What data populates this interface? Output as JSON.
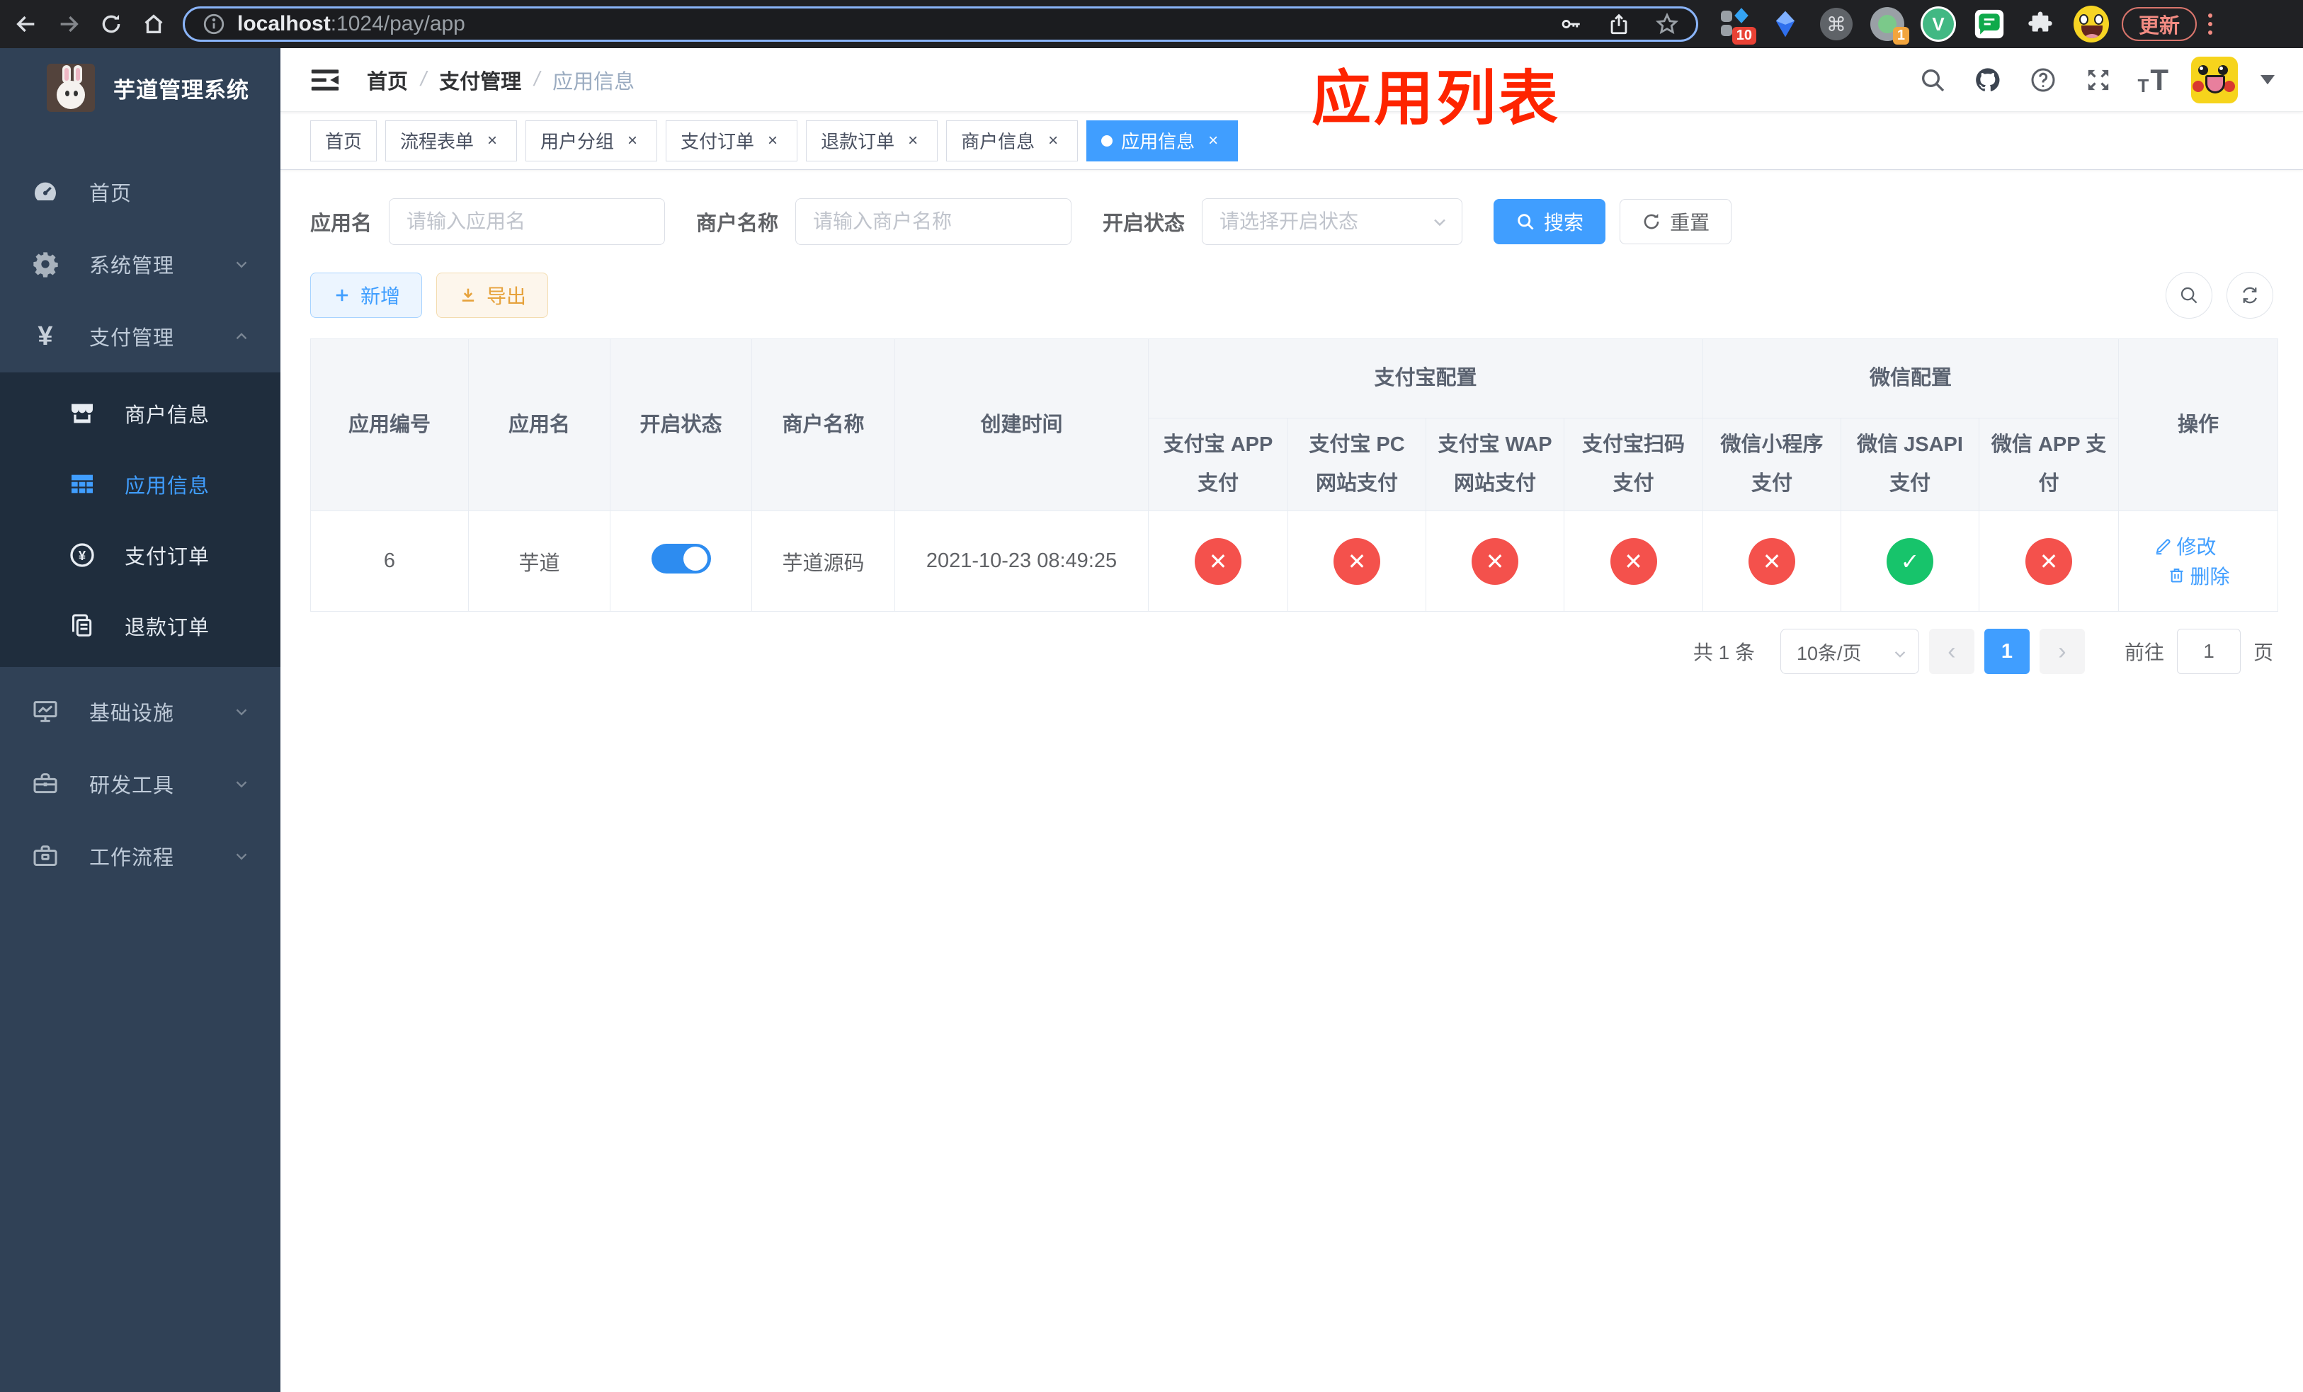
{
  "browser": {
    "url": {
      "host": "localhost",
      "rest": ":1024/pay/app"
    },
    "ext_badge_blocks": "10",
    "ext_badge_profile": "1",
    "ext_vue_letter": "V",
    "cmd_glyph": "⌘",
    "update_label": "更新"
  },
  "sidebar": {
    "title": "芋道管理系统",
    "menu": [
      {
        "label": "首页"
      },
      {
        "label": "系统管理"
      },
      {
        "label": "支付管理",
        "yen": "¥",
        "children": [
          {
            "label": "商户信息"
          },
          {
            "label": "应用信息",
            "state": "active"
          },
          {
            "label": "支付订单"
          },
          {
            "label": "退款订单"
          }
        ]
      },
      {
        "label": "基础设施"
      },
      {
        "label": "研发工具"
      },
      {
        "label": "工作流程"
      }
    ]
  },
  "navbar": {
    "breadcrumb": [
      "首页",
      "支付管理",
      "应用信息"
    ],
    "annotation": "应用列表"
  },
  "tabs": [
    {
      "label": "首页"
    },
    {
      "label": "流程表单"
    },
    {
      "label": "用户分组"
    },
    {
      "label": "支付订单"
    },
    {
      "label": "退款订单"
    },
    {
      "label": "商户信息"
    },
    {
      "label": "应用信息",
      "state": "active"
    }
  ],
  "filters": {
    "app_name": {
      "label": "应用名",
      "placeholder": "请输入应用名"
    },
    "merchant_name": {
      "label": "商户名称",
      "placeholder": "请输入商户名称"
    },
    "status": {
      "label": "开启状态",
      "placeholder": "请选择开启状态"
    },
    "search_label": "搜索",
    "reset_label": "重置"
  },
  "toolbar": {
    "add_label": "新增",
    "export_label": "导出"
  },
  "table": {
    "headers": {
      "id": "应用编号",
      "name": "应用名",
      "status": "开启状态",
      "merchant": "商户名称",
      "created": "创建时间",
      "alipay_group": "支付宝配置",
      "wechat_group": "微信配置",
      "channels": [
        "支付宝 APP 支付",
        "支付宝 PC 网站支付",
        "支付宝 WAP 网站支付",
        "支付宝扫码支付",
        "微信小程序支付",
        "微信 JSAPI 支付",
        "微信 APP 支付"
      ],
      "actions": "操作"
    },
    "rows": [
      {
        "id": "6",
        "name": "芋道",
        "enabled": "on",
        "merchant": "芋道源码",
        "created": "2021-10-23 08:49:25",
        "channels": [
          "no",
          "no",
          "no",
          "no",
          "no",
          "yes",
          "no"
        ],
        "edit_label": "修改",
        "delete_label": "删除"
      }
    ]
  },
  "pagination": {
    "total": "共 1 条",
    "page_size": "10条/页",
    "prev": "‹",
    "page": "1",
    "next": "›",
    "goto_label": "前往",
    "goto_value": "1",
    "unit": "页"
  },
  "colors": {
    "primary": "#409eff",
    "success": "#17c46b",
    "danger": "#f4514c",
    "warning": "#e6a23c",
    "sidebar": "#304156",
    "sidebar_submenu": "#1f2d3d",
    "annotation_red": "#fe2400"
  }
}
